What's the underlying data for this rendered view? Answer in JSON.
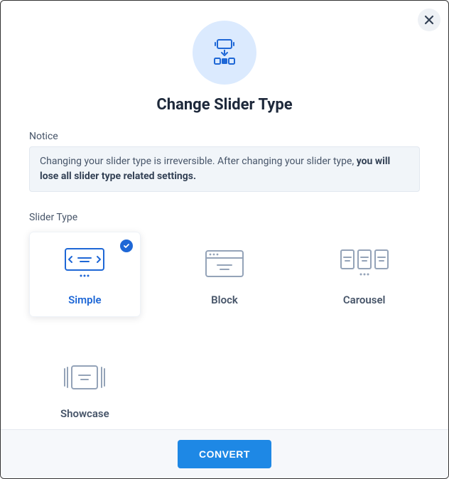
{
  "title": "Change Slider Type",
  "notice": {
    "label": "Notice",
    "text_start": "Changing your slider type is irreversible. After changing your slider type, ",
    "text_bold": "you will lose all slider type related settings."
  },
  "slider_type": {
    "label": "Slider Type",
    "selected": "simple",
    "options": {
      "simple": "Simple",
      "block": "Block",
      "carousel": "Carousel",
      "showcase": "Showcase"
    }
  },
  "footer": {
    "convert": "CONVERT"
  }
}
